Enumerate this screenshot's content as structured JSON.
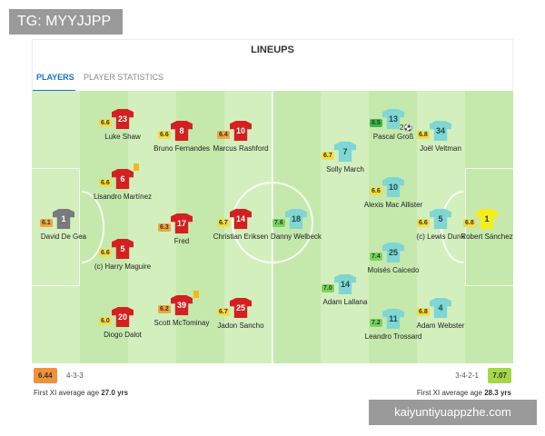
{
  "tg_badge": "TG: MYYJJPP",
  "title": "LINEUPS",
  "tabs": [
    {
      "label": "PLAYERS",
      "active": true
    },
    {
      "label": "PLAYER STATISTICS",
      "active": false
    }
  ],
  "home": {
    "rating": "6.44",
    "formation": "4-3-3",
    "age_label": "First XI average age",
    "age_value": "27.0 yrs",
    "players": {
      "degea": {
        "num": "1",
        "name": "David De Gea",
        "rating": "6.1"
      },
      "shaw": {
        "num": "23",
        "name": "Luke Shaw",
        "rating": "6.6"
      },
      "martinez": {
        "num": "6",
        "name": "Lisandro Martínez",
        "rating": "6.6"
      },
      "maguire": {
        "num": "5",
        "name": "(c) Harry Maguire",
        "rating": "6.6"
      },
      "dalot": {
        "num": "20",
        "name": "Diogo Dalot",
        "rating": "6.0"
      },
      "fernandes": {
        "num": "8",
        "name": "Bruno Fernandes",
        "rating": "6.6"
      },
      "fred": {
        "num": "17",
        "name": "Fred",
        "rating": "6.3"
      },
      "mctominay": {
        "num": "39",
        "name": "Scott McTominay",
        "rating": "6.2"
      },
      "rashford": {
        "num": "10",
        "name": "Marcus Rashford",
        "rating": "6.4"
      },
      "eriksen": {
        "num": "14",
        "name": "Christian Eriksen",
        "rating": "6.7"
      },
      "sancho": {
        "num": "25",
        "name": "Jadon Sancho",
        "rating": "6.7"
      }
    }
  },
  "away": {
    "rating": "7.07",
    "formation": "3-4-2-1",
    "age_label": "First XI average age",
    "age_value": "28.3 yrs",
    "players": {
      "sanchez": {
        "num": "1",
        "name": "Robert Sánchez",
        "rating": "6.8"
      },
      "veltman": {
        "num": "34",
        "name": "Joël Veltman",
        "rating": "6.8"
      },
      "dunk": {
        "num": "5",
        "name": "(c) Lewis Dunk",
        "rating": "6.6"
      },
      "webster": {
        "num": "4",
        "name": "Adam Webster",
        "rating": "6.8"
      },
      "gross": {
        "num": "13",
        "name": "Pascal Groß",
        "rating": "8.5"
      },
      "macallister": {
        "num": "10",
        "name": "Alexis Mac Allister",
        "rating": "6.6"
      },
      "caicedo": {
        "num": "25",
        "name": "Moisés Caicedo",
        "rating": "7.4"
      },
      "trossard": {
        "num": "11",
        "name": "Leandro Trossard",
        "rating": "7.2"
      },
      "march": {
        "num": "7",
        "name": "Solly March",
        "rating": "6.7"
      },
      "lallana": {
        "num": "14",
        "name": "Adam Lallana",
        "rating": "7.0"
      },
      "welbeck": {
        "num": "18",
        "name": "Danny Welbeck",
        "rating": "7.6"
      }
    },
    "gross_goals_label": "2"
  },
  "watermark": "kaiyuntiyuappzhe.com"
}
